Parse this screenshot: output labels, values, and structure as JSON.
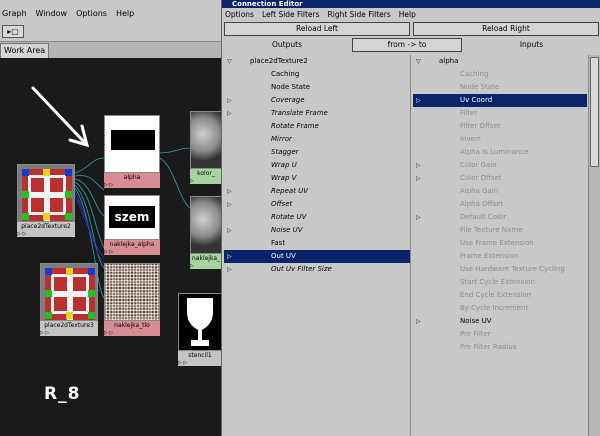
{
  "left_window": {
    "menu": [
      "Graph",
      "Window",
      "Options",
      "Help"
    ],
    "toolbar_icon": "arrow-icon",
    "tab_label": "Work Area",
    "nodes": {
      "place1": "place2dTexture2",
      "place2": "place2dTexture3",
      "alpha": "alpha",
      "szem_text": "szem",
      "naklejka_alpha": "naklejka_alpha",
      "naklejka_tlo": "naklejka_tlo",
      "kolor": "kolor_",
      "naklejka_mid": "naklejka_",
      "stencil": "stencil1"
    },
    "overlay_text": "R_8"
  },
  "connection_editor": {
    "title": "Connection Editor",
    "menu": [
      "Options",
      "Left Side Filters",
      "Right Side Filters",
      "Help"
    ],
    "reload_left": "Reload Left",
    "reload_right": "Reload Right",
    "outputs_label": "Outputs",
    "direction_button": "from -> to",
    "inputs_label": "Inputs",
    "left_list": [
      {
        "text": "place2dTexture2",
        "arrow": "▽",
        "style": "header"
      },
      {
        "text": "Caching",
        "arrow": "",
        "style": "normal"
      },
      {
        "text": "Node State",
        "arrow": "",
        "style": "normal"
      },
      {
        "text": "Coverage",
        "arrow": "▷",
        "style": "italic"
      },
      {
        "text": "Translate Frame",
        "arrow": "▷",
        "style": "italic"
      },
      {
        "text": "Rotate Frame",
        "arrow": "",
        "style": "italic"
      },
      {
        "text": "Mirror",
        "arrow": "",
        "style": "italic"
      },
      {
        "text": "Stagger",
        "arrow": "",
        "style": "italic"
      },
      {
        "text": "Wrap U",
        "arrow": "",
        "style": "italic"
      },
      {
        "text": "Wrap V",
        "arrow": "",
        "style": "italic"
      },
      {
        "text": "Repeat UV",
        "arrow": "▷",
        "style": "italic"
      },
      {
        "text": "Offset",
        "arrow": "▷",
        "style": "italic"
      },
      {
        "text": "Rotate UV",
        "arrow": "",
        "style": "italic"
      },
      {
        "text": "Noise UV",
        "arrow": "▷",
        "style": "italic"
      },
      {
        "text": "Fast",
        "arrow": "",
        "style": "normal"
      },
      {
        "text": "Out UV",
        "arrow": "▷",
        "style": "selected"
      },
      {
        "text": "Out Uv Filter Size",
        "arrow": "▷",
        "style": "italic"
      }
    ],
    "right_list": [
      {
        "text": "alpha",
        "arrow": "▽",
        "style": "header"
      },
      {
        "text": "Caching",
        "arrow": "",
        "style": "disabled"
      },
      {
        "text": "Node State",
        "arrow": "",
        "style": "disabled"
      },
      {
        "text": "Uv Coord",
        "arrow": "▷",
        "style": "selected"
      },
      {
        "text": "Filter",
        "arrow": "",
        "style": "disabled"
      },
      {
        "text": "Filter Offset",
        "arrow": "",
        "style": "disabled"
      },
      {
        "text": "Invert",
        "arrow": "",
        "style": "disabled"
      },
      {
        "text": "Alpha Is Luminance",
        "arrow": "",
        "style": "disabled"
      },
      {
        "text": "Color Gain",
        "arrow": "▷",
        "style": "disabled"
      },
      {
        "text": "Color Offset",
        "arrow": "▷",
        "style": "disabled"
      },
      {
        "text": "Alpha Gain",
        "arrow": "",
        "style": "disabled"
      },
      {
        "text": "Alpha Offset",
        "arrow": "",
        "style": "disabled"
      },
      {
        "text": "Default Color",
        "arrow": "▷",
        "style": "disabled"
      },
      {
        "text": "File Texture Name",
        "arrow": "",
        "style": "disabled"
      },
      {
        "text": "Use Frame Extension",
        "arrow": "",
        "style": "disabled"
      },
      {
        "text": "Frame Extension",
        "arrow": "",
        "style": "disabled"
      },
      {
        "text": "Use Hardware Texture Cycling",
        "arrow": "",
        "style": "disabled"
      },
      {
        "text": "Start Cycle Extension",
        "arrow": "",
        "style": "disabled"
      },
      {
        "text": "End Cycle Extension",
        "arrow": "",
        "style": "disabled"
      },
      {
        "text": "By Cycle Increment",
        "arrow": "",
        "style": "disabled"
      },
      {
        "text": "Noise UV",
        "arrow": "▷",
        "style": "normal"
      },
      {
        "text": "Pre Filter",
        "arrow": "",
        "style": "disabled"
      },
      {
        "text": "Pre Filter Radius",
        "arrow": "",
        "style": "disabled"
      }
    ]
  }
}
